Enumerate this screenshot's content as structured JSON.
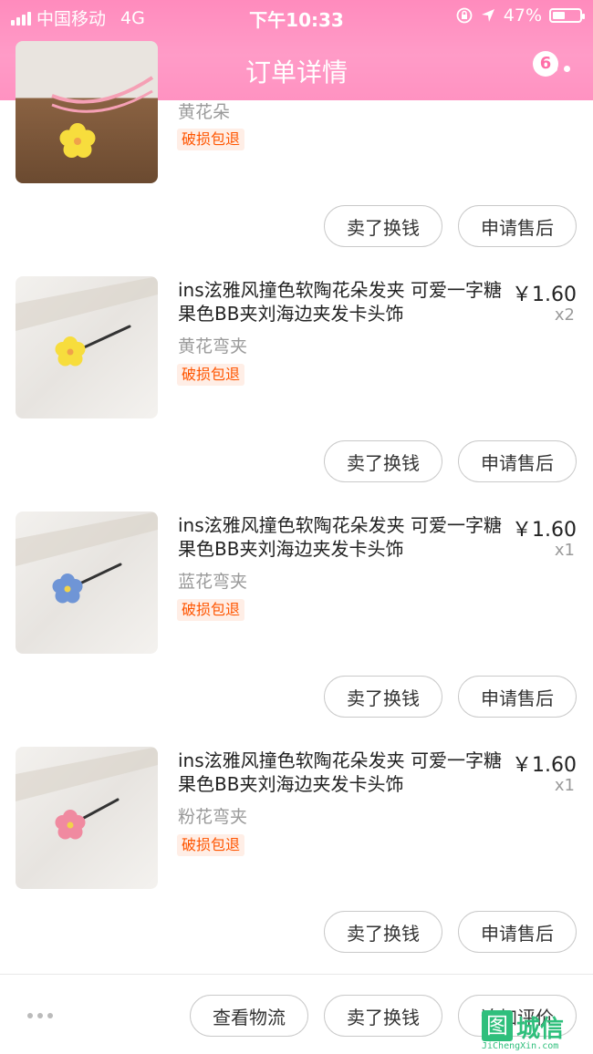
{
  "status_bar": {
    "carrier": "中国移动",
    "network": "4G",
    "time": "下午10:33",
    "battery": "47%",
    "battery_level": 0.47
  },
  "header": {
    "title": "订单详情",
    "badge_count": "6"
  },
  "items": [
    {
      "title": "",
      "price": "",
      "qty": "",
      "spec": "黄花朵",
      "tag": "破损包退",
      "flower_color": "#f7dd3d",
      "buttons": [
        "卖了换钱",
        "申请售后"
      ]
    },
    {
      "title": "ins泫雅风撞色软陶花朵发夹 可爱一字糖果色BB夹刘海边夹发卡头饰",
      "price": "￥1.60",
      "qty": "x2",
      "spec": "黄花弯夹",
      "tag": "破损包退",
      "flower_color": "#f7dd3d",
      "buttons": [
        "卖了换钱",
        "申请售后"
      ]
    },
    {
      "title": "ins泫雅风撞色软陶花朵发夹 可爱一字糖果色BB夹刘海边夹发卡头饰",
      "price": "￥1.60",
      "qty": "x1",
      "spec": "蓝花弯夹",
      "tag": "破损包退",
      "flower_color": "#6f95d6",
      "buttons": [
        "卖了换钱",
        "申请售后"
      ]
    },
    {
      "title": "ins泫雅风撞色软陶花朵发夹 可爱一字糖果色BB夹刘海边夹发卡头饰",
      "price": "￥1.60",
      "qty": "x1",
      "spec": "粉花弯夹",
      "tag": "破损包退",
      "flower_color": "#f08aa0",
      "buttons": [
        "卖了换钱",
        "申请售后"
      ]
    }
  ],
  "bottom_bar": {
    "buttons": [
      "查看物流",
      "卖了换钱",
      "追加评价"
    ]
  },
  "watermark": {
    "box_char": "图",
    "text": "城信",
    "sub": "JiChengXin.com"
  },
  "colors": {
    "header_pink": "#ff92c1",
    "tag_orange": "#ff5500",
    "watermark_green": "#2fbf7c"
  }
}
